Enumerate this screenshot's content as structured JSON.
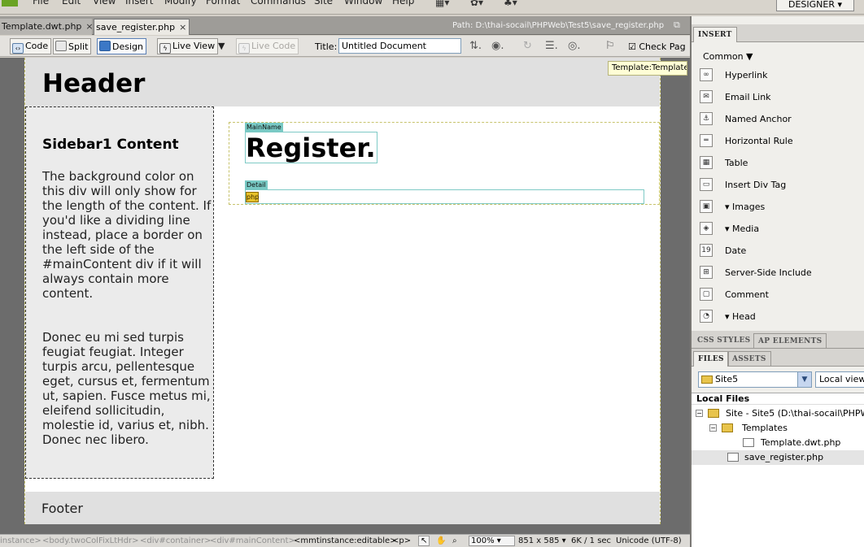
{
  "menubar": {
    "items": [
      "File",
      "Edit",
      "View",
      "Insert",
      "Modify",
      "Format",
      "Commands",
      "Site",
      "Window",
      "Help"
    ],
    "workspace": "DESIGNER"
  },
  "doc_tabs": {
    "tabs": [
      {
        "label": "Template.dwt.php",
        "close": "×"
      },
      {
        "label": "save_register.php",
        "close": "×"
      }
    ],
    "path": "Path: D:\\thai-socail\\PHPWeb\\Test5\\save_register.php"
  },
  "toolbar": {
    "code": "Code",
    "split": "Split",
    "design": "Design",
    "live_view": "Live View",
    "live_code": "Live Code",
    "title_label": "Title:",
    "title_value": "Untitled Document",
    "check_page": "Check Pag"
  },
  "page": {
    "header": "Header",
    "template_tag": "Template:Template",
    "sidebar_title": "Sidebar1 Content",
    "sidebar_p1": "The background color on this div will only show for the length of the content. If you'd like a dividing line instead, place a border on the left side of the #mainContent div if it will always contain more content.",
    "sidebar_p2": "Donec eu mi sed turpis feugiat feugiat. Integer turpis arcu, pellentesque eget, cursus et, fermentum ut, sapien. Fusce metus mi, eleifend sollicitudin, molestie id, varius et, nibh. Donec nec libero.",
    "mainname_tab": "MainName",
    "register": "Register.",
    "detail_tab": "Detail",
    "php_icon": "php",
    "footer": "Footer"
  },
  "statusbar": {
    "tags": [
      "instance>",
      "<body.twoColFixLtHdr>",
      "<div#container>",
      "<div#mainContent>",
      "<mmtinstance:editable>",
      "<p>"
    ],
    "zoom": "100%",
    "window_size": "851 x 585",
    "download": "6K / 1 sec",
    "encoding": "Unicode (UTF-8)"
  },
  "insert_panel": {
    "tab": "INSERT",
    "category": "Common",
    "items": [
      {
        "label": "Hyperlink",
        "icon": "hyperlink-icon",
        "glyph": "∞"
      },
      {
        "label": "Email Link",
        "icon": "email-link-icon",
        "glyph": "✉"
      },
      {
        "label": "Named Anchor",
        "icon": "named-anchor-icon",
        "glyph": "⚓"
      },
      {
        "label": "Horizontal Rule",
        "icon": "horizontal-rule-icon",
        "glyph": "═"
      },
      {
        "label": "Table",
        "icon": "table-icon",
        "glyph": "▦"
      },
      {
        "label": "Insert Div Tag",
        "icon": "div-tag-icon",
        "glyph": "▭"
      },
      {
        "label": "Images",
        "icon": "images-icon",
        "glyph": "▣"
      },
      {
        "label": "Media",
        "icon": "media-icon",
        "glyph": "◈"
      },
      {
        "label": "Date",
        "icon": "date-icon",
        "glyph": "19"
      },
      {
        "label": "Server-Side Include",
        "icon": "server-side-include-icon",
        "glyph": "⊞"
      },
      {
        "label": "Comment",
        "icon": "comment-icon",
        "glyph": "▢"
      },
      {
        "label": "Head",
        "icon": "head-icon",
        "glyph": "◔"
      }
    ]
  },
  "css_panel": {
    "tabs": [
      "CSS STYLES",
      "AP ELEMENTS"
    ]
  },
  "files_panel": {
    "tabs": [
      "FILES",
      "ASSETS"
    ],
    "site": "Site5",
    "view": "Local view",
    "local_files": "Local Files",
    "tree": [
      {
        "label": "Site - Site5 (D:\\thai-socail\\PHPW...",
        "expander": "−"
      },
      {
        "label": "Templates",
        "expander": "−"
      },
      {
        "label": "Template.dwt.php",
        "expander": ""
      },
      {
        "label": "save_register.php",
        "expander": ""
      }
    ]
  },
  "colors": {
    "canvas_bg": "#6c6c6c",
    "editable_region_tab": "#78c9c4",
    "template_tag_bg": "#fffed6",
    "logo": "#6aa323"
  }
}
